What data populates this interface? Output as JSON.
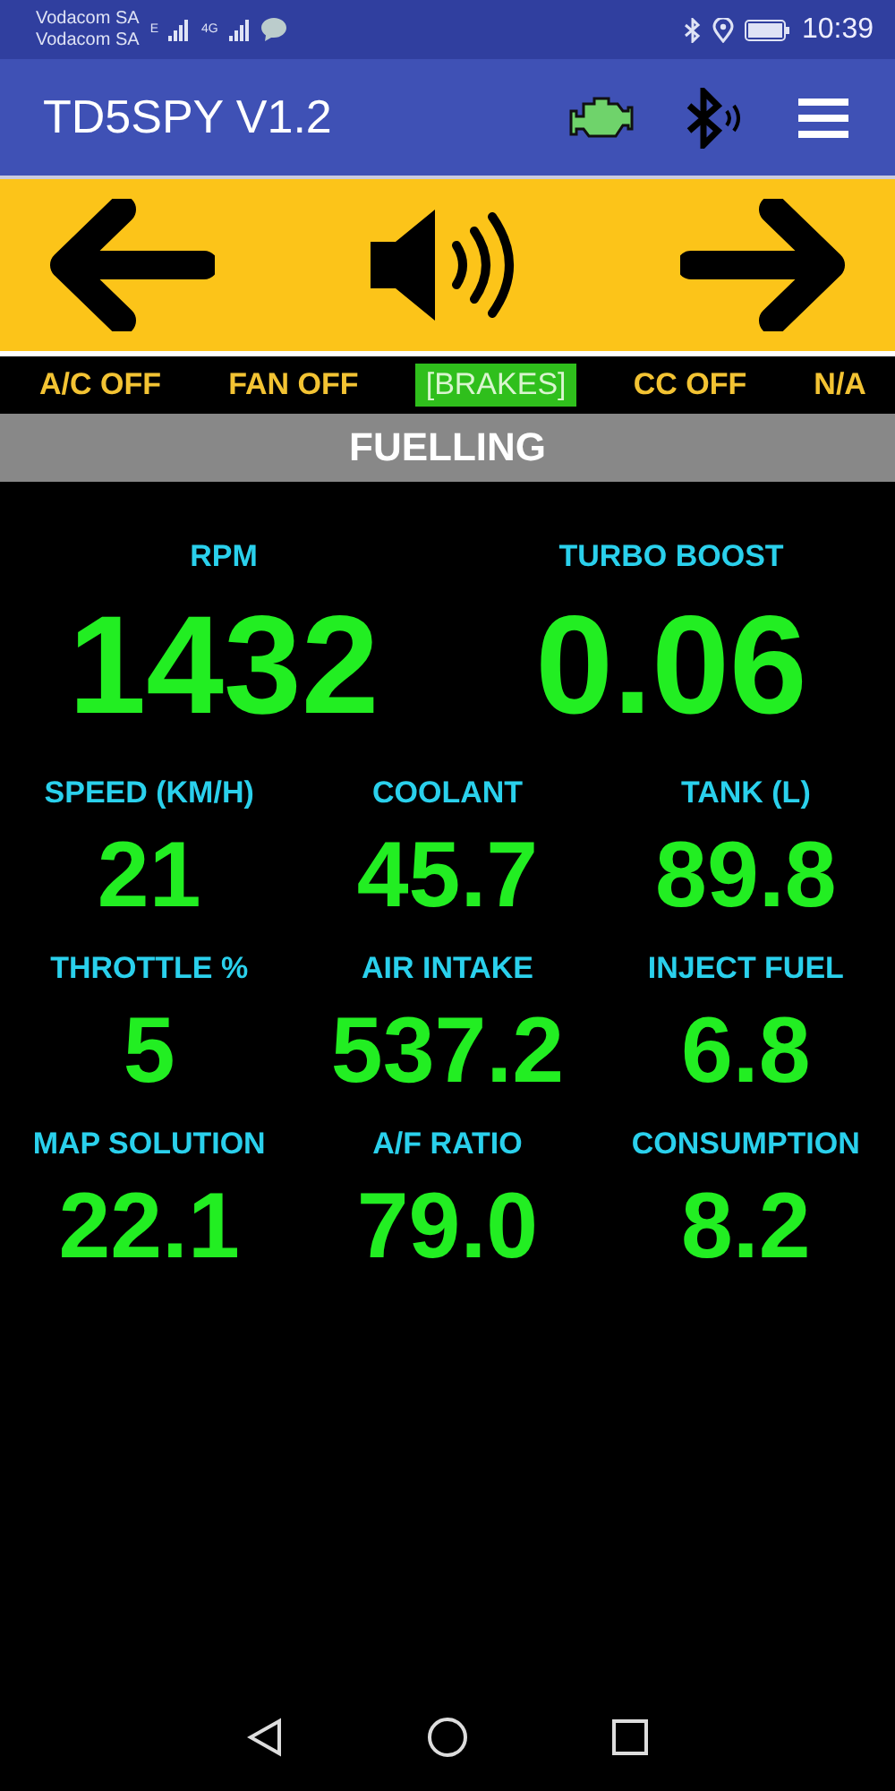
{
  "status_bar": {
    "carriers": [
      "Vodacom SA",
      "Vodacom SA"
    ],
    "network_1": "E",
    "network_2": "4G",
    "time": "10:39"
  },
  "app_bar": {
    "title": "TD5SPY V1.2"
  },
  "indicators": [
    {
      "label": "A/C OFF",
      "on": false
    },
    {
      "label": "FAN OFF",
      "on": false
    },
    {
      "label": "[BRAKES]",
      "on": true
    },
    {
      "label": "CC OFF",
      "on": false
    },
    {
      "label": "N/A",
      "on": false
    }
  ],
  "page_title": "FUELLING",
  "metric_rows": [
    {
      "kind": "large",
      "items": [
        {
          "label": "RPM",
          "value": "1432"
        },
        {
          "label": "TURBO BOOST",
          "value": "0.06"
        }
      ]
    },
    {
      "kind": "normal",
      "items": [
        {
          "label": "SPEED (KM/H)",
          "value": "21"
        },
        {
          "label": "COOLANT",
          "value": "45.7"
        },
        {
          "label": "TANK (L)",
          "value": "89.8"
        }
      ]
    },
    {
      "kind": "normal",
      "items": [
        {
          "label": "THROTTLE %",
          "value": "5"
        },
        {
          "label": "AIR INTAKE",
          "value": "537.2"
        },
        {
          "label": "INJECT FUEL",
          "value": "6.8"
        }
      ]
    },
    {
      "kind": "normal",
      "items": [
        {
          "label": "MAP SOLUTION",
          "value": "22.1"
        },
        {
          "label": "A/F RATIO",
          "value": "79.0"
        },
        {
          "label": "CONSUMPTION",
          "value": "8.2"
        }
      ]
    }
  ]
}
